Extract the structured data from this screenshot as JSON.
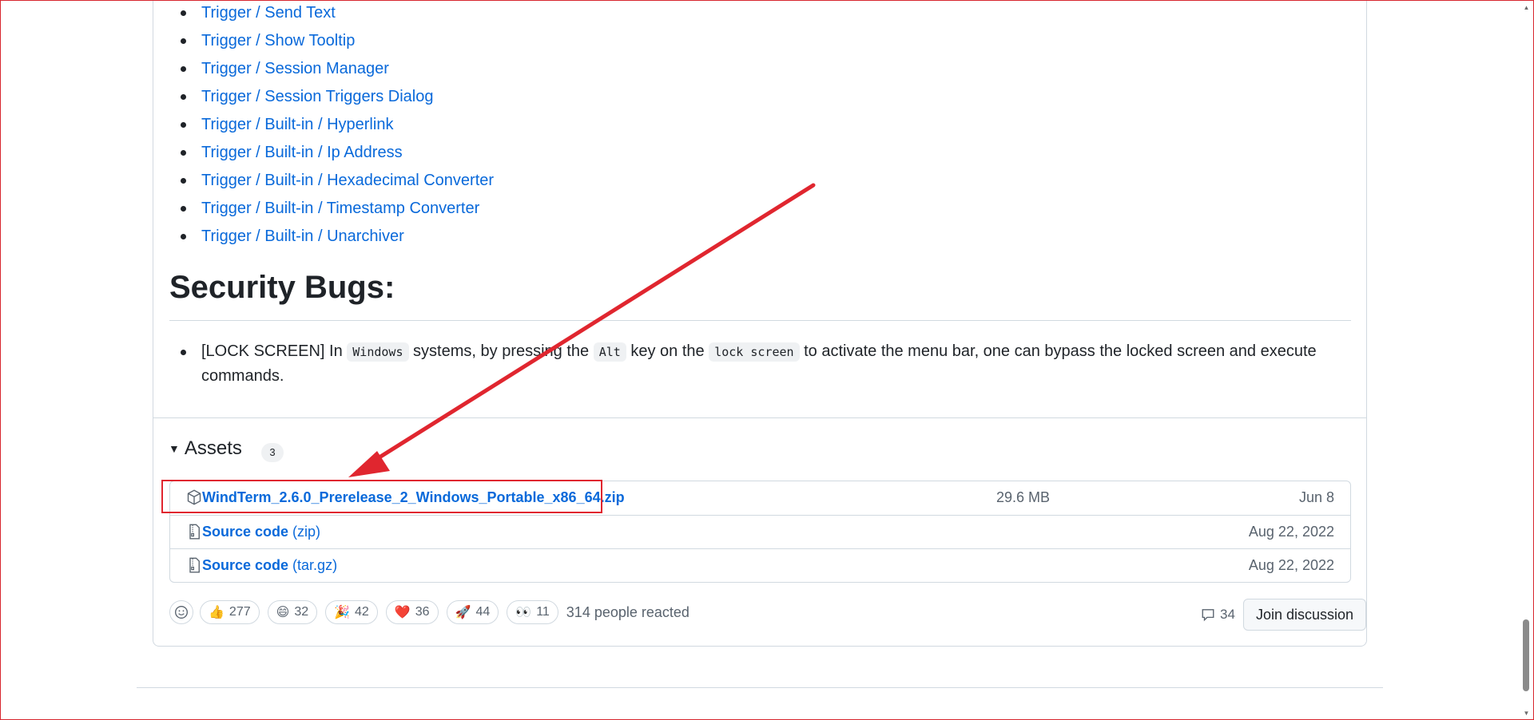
{
  "trigger_links": [
    "Trigger / Send Text",
    "Trigger / Show Tooltip",
    "Trigger / Session Manager",
    "Trigger / Session Triggers Dialog",
    "Trigger / Built-in / Hyperlink",
    "Trigger / Built-in / Ip Address",
    "Trigger / Built-in / Hexadecimal Converter",
    "Trigger / Built-in / Timestamp Converter",
    "Trigger / Built-in / Unarchiver"
  ],
  "security": {
    "heading": "Security Bugs:",
    "bug_prefix": "[LOCK SCREEN] In ",
    "code_windows": "Windows",
    "text_middle": " systems, by pressing the ",
    "code_alt": "Alt",
    "text_key": " key on the ",
    "code_lock": "lock screen",
    "text_end": " to activate the menu bar, one can bypass the locked screen and execute commands."
  },
  "assets": {
    "toggle_label": "Assets",
    "count": "3",
    "rows": [
      {
        "name": "WindTerm_2.6.0_Prerelease_2_Windows_Portable_x86_64.zip",
        "suffix": "",
        "size": "29.6 MB",
        "date": "Jun 8",
        "icon": "package-icon"
      },
      {
        "name": "Source code",
        "suffix": " (zip)",
        "size": "",
        "date": "Aug 22, 2022",
        "icon": "file-zip-icon"
      },
      {
        "name": "Source code",
        "suffix": " (tar.gz)",
        "size": "",
        "date": "Aug 22, 2022",
        "icon": "file-zip-icon"
      }
    ]
  },
  "reactions": {
    "items": [
      {
        "emoji": "👍",
        "count": "277",
        "name": "thumbs-up"
      },
      {
        "emoji": "😄",
        "count": "32",
        "name": "laugh"
      },
      {
        "emoji": "🎉",
        "count": "42",
        "name": "hooray"
      },
      {
        "emoji": "❤️",
        "count": "36",
        "name": "heart"
      },
      {
        "emoji": "🚀",
        "count": "44",
        "name": "rocket"
      },
      {
        "emoji": "👀",
        "count": "11",
        "name": "eyes"
      }
    ],
    "summary": "314 people reacted"
  },
  "discussion": {
    "comment_count": "34",
    "join_label": "Join discussion"
  },
  "colors": {
    "link": "#0969da",
    "annotation_red": "#e0262f",
    "border": "#d1d9e0"
  }
}
